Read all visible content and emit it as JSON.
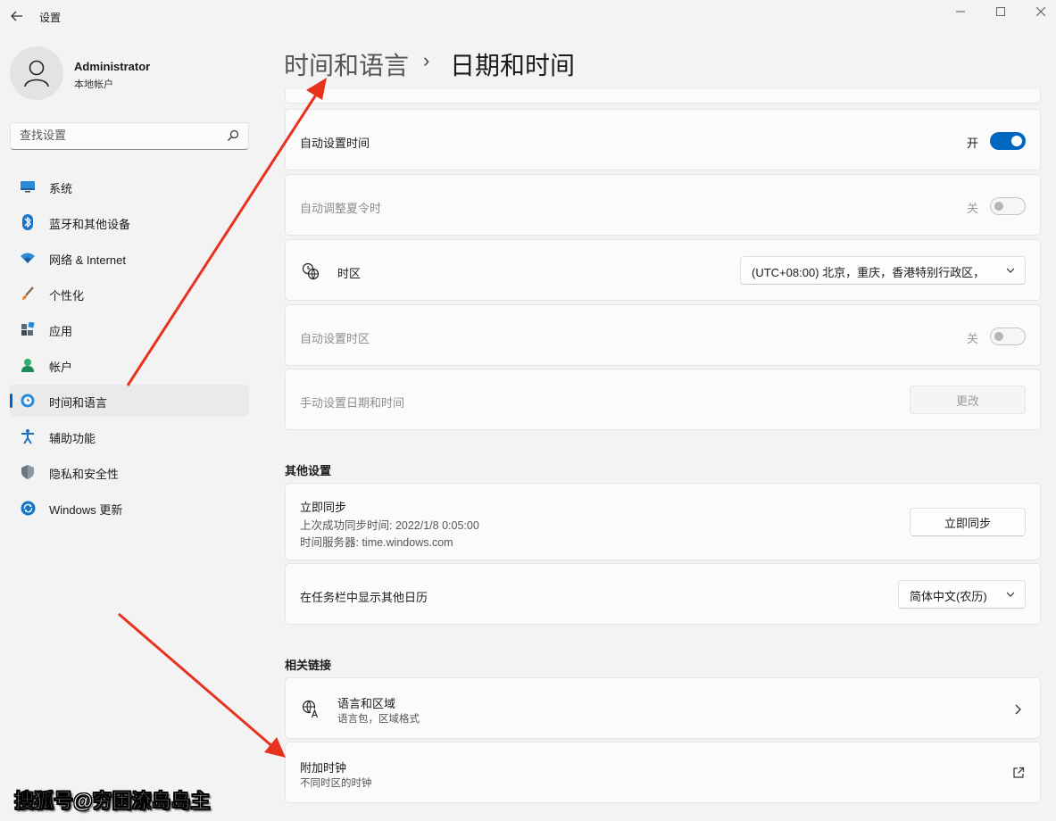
{
  "window": {
    "app_title": "设置"
  },
  "user": {
    "name": "Administrator",
    "account_type": "本地帐户"
  },
  "search": {
    "placeholder": "查找设置"
  },
  "nav": {
    "items": [
      {
        "label": "系统",
        "icon": "monitor-icon"
      },
      {
        "label": "蓝牙和其他设备",
        "icon": "bluetooth-icon"
      },
      {
        "label": "网络 & Internet",
        "icon": "wifi-icon"
      },
      {
        "label": "个性化",
        "icon": "brush-icon"
      },
      {
        "label": "应用",
        "icon": "apps-icon"
      },
      {
        "label": "帐户",
        "icon": "person-icon"
      },
      {
        "label": "时间和语言",
        "icon": "globe-clock-icon",
        "active": true
      },
      {
        "label": "辅助功能",
        "icon": "accessibility-icon"
      },
      {
        "label": "隐私和安全性",
        "icon": "shield-icon"
      },
      {
        "label": "Windows 更新",
        "icon": "update-icon"
      }
    ]
  },
  "breadcrumb": {
    "parent": "时间和语言",
    "separator": "›",
    "current": "日期和时间"
  },
  "settings": {
    "auto_time": {
      "label": "自动设置时间",
      "state_text": "开",
      "on": true
    },
    "auto_dst": {
      "label": "自动调整夏令时",
      "state_text": "关",
      "on": false,
      "disabled": true
    },
    "timezone": {
      "label": "时区",
      "value": "(UTC+08:00) 北京，重庆，香港特别行政区，"
    },
    "auto_timezone": {
      "label": "自动设置时区",
      "state_text": "关",
      "on": false,
      "disabled": true
    },
    "manual": {
      "label": "手动设置日期和时间",
      "button": "更改",
      "disabled": true
    }
  },
  "other": {
    "title": "其他设置",
    "sync": {
      "label": "立即同步",
      "last_sync": "上次成功同步时间: 2022/1/8 0:05:00",
      "server": "时间服务器: time.windows.com",
      "button": "立即同步"
    },
    "calendar": {
      "label": "在任务栏中显示其他日历",
      "value": "简体中文(农历)"
    }
  },
  "related": {
    "title": "相关链接",
    "language_region": {
      "label": "语言和区域",
      "sub": "语言包，区域格式"
    },
    "additional_clocks": {
      "label": "附加时钟",
      "sub": "不同时区的时钟"
    }
  },
  "watermark": "搜狐号@穷困潦岛岛主",
  "colors": {
    "accent": "#0067c0",
    "annotation_arrow": "#e8321e",
    "background": "#f3f3f3",
    "card": "#fbfbfb"
  }
}
